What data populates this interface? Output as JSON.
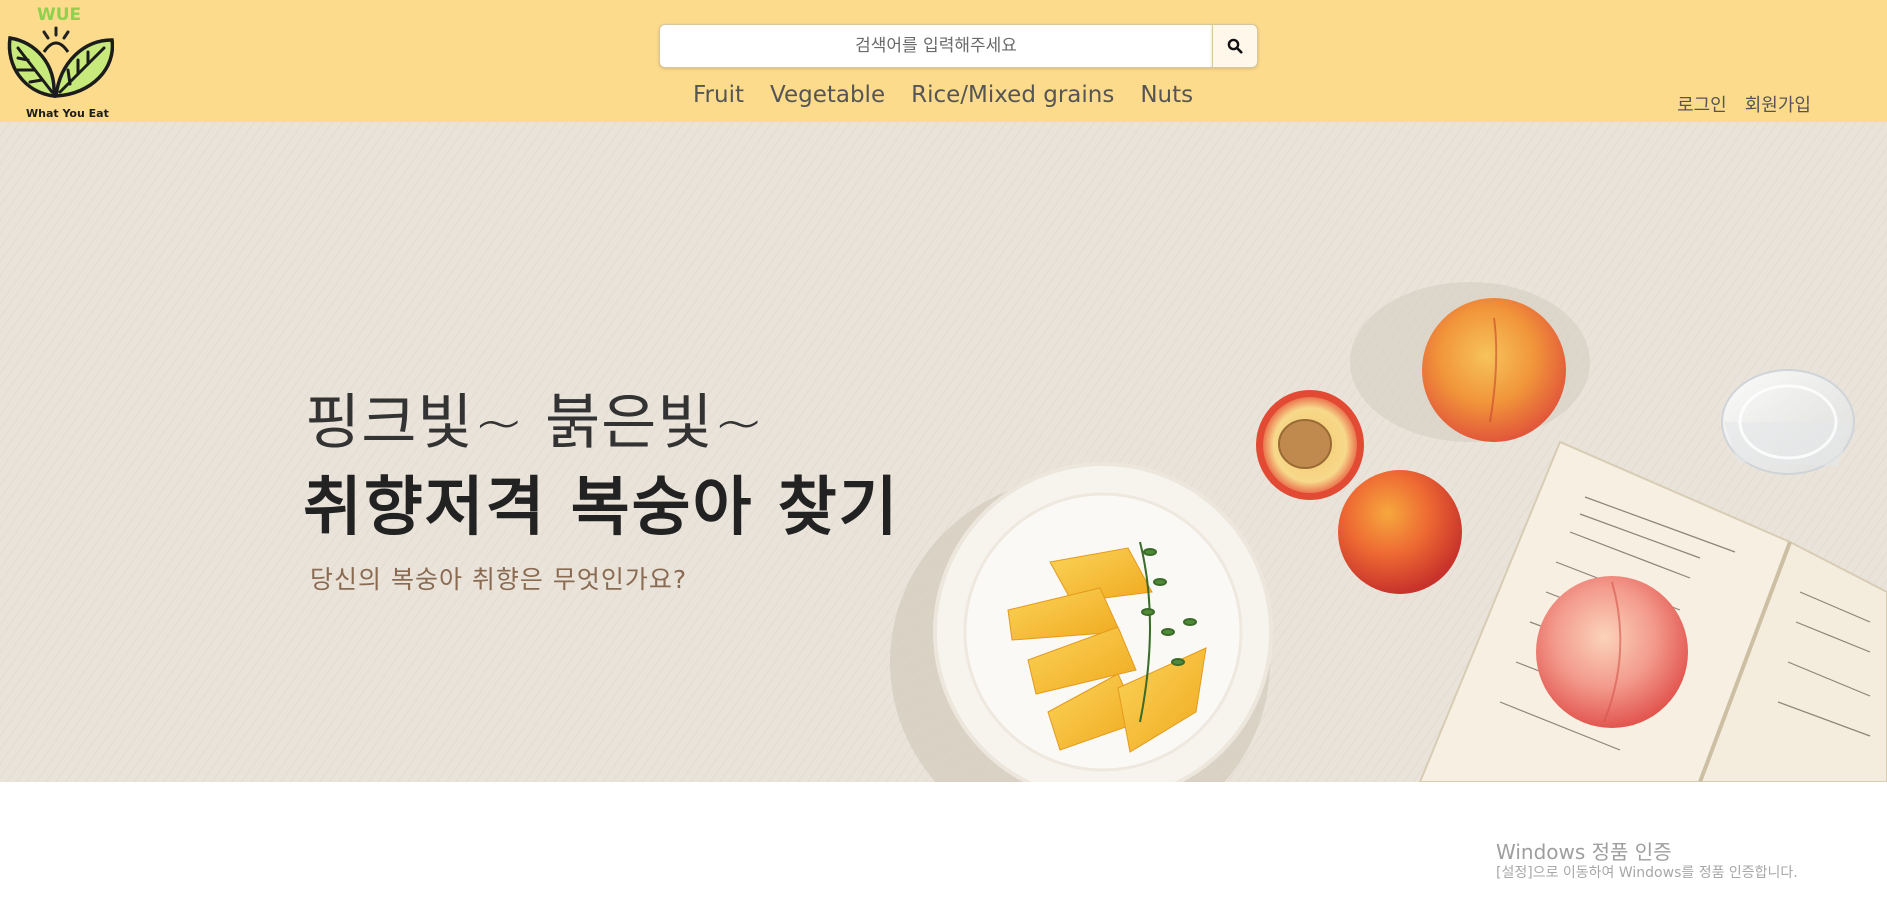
{
  "brand": {
    "logo_label": "WUE",
    "logo_tagline": "What You Eat"
  },
  "search": {
    "placeholder": "검색어를 입력해주세요",
    "value": "",
    "button_icon": "search-icon"
  },
  "nav": {
    "items": [
      {
        "label": "Fruit"
      },
      {
        "label": "Vegetable"
      },
      {
        "label": "Rice/Mixed grains"
      },
      {
        "label": "Nuts"
      }
    ]
  },
  "auth": {
    "login_label": "로그인",
    "signup_label": "회원가입"
  },
  "hero": {
    "line1": "핑크빛~ 붉은빛~",
    "line2": "취향저격 복숭아 찾기",
    "subtitle": "당신의 복숭아 취향은 무엇인가요?"
  },
  "watermark": {
    "title": "Windows 정품 인증",
    "subtitle": "[설정]으로 이동하여 Windows를 정품 인증합니다."
  },
  "colors": {
    "header_bg": "#fddb8c",
    "hero_bg": "#e9e3da",
    "subtitle": "#8a6a50",
    "logo_green": "#8fd14f"
  }
}
